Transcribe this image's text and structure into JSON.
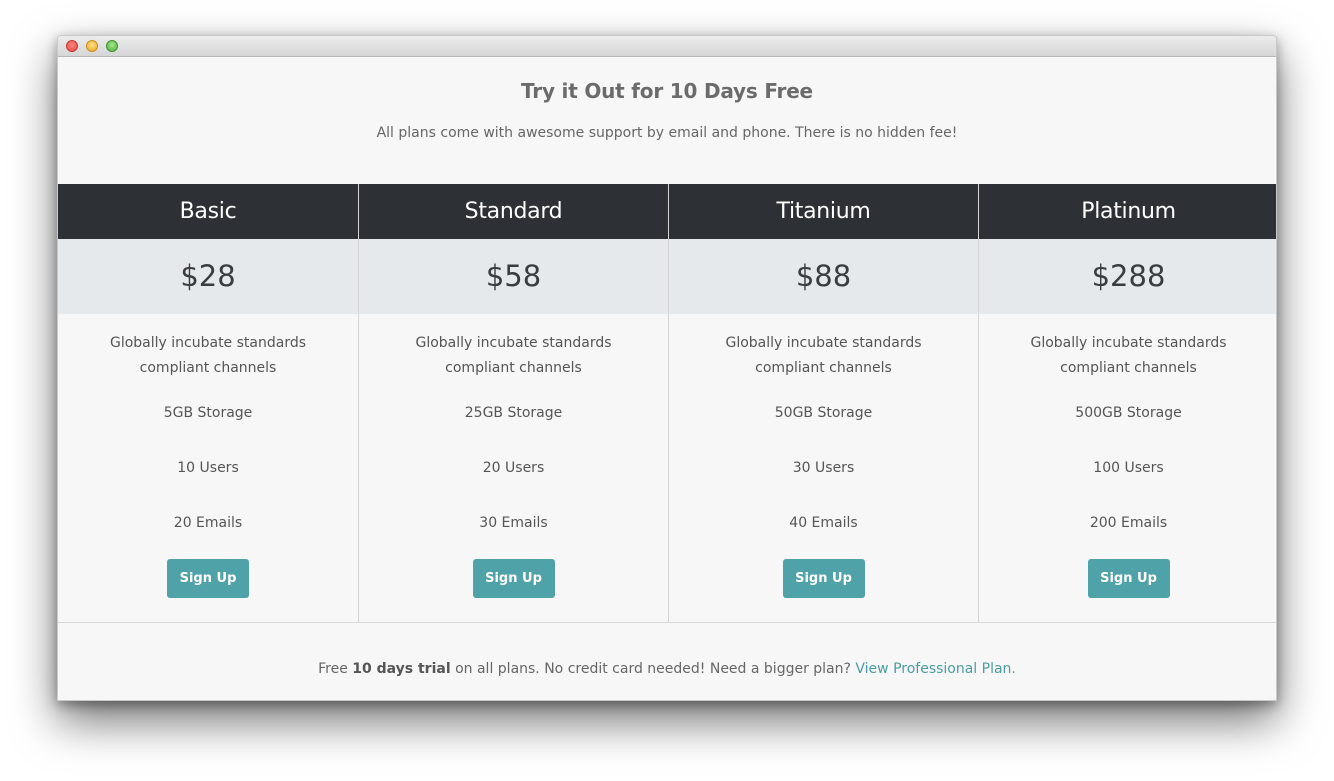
{
  "header": {
    "title": "Try it Out for 10 Days Free",
    "subtitle": "All plans come with awesome support by email and phone. There is no hidden fee!"
  },
  "plans": [
    {
      "name": "Basic",
      "price": "$28",
      "description": "Globally incubate standards compliant channels",
      "storage": "5GB Storage",
      "users": "10 Users",
      "emails": "20 Emails",
      "button": "Sign Up"
    },
    {
      "name": "Standard",
      "price": "$58",
      "description": "Globally incubate standards compliant channels",
      "storage": "25GB Storage",
      "users": "20 Users",
      "emails": "30 Emails",
      "button": "Sign Up"
    },
    {
      "name": "Titanium",
      "price": "$88",
      "description": "Globally incubate standards compliant channels",
      "storage": "50GB Storage",
      "users": "30 Users",
      "emails": "40 Emails",
      "button": "Sign Up"
    },
    {
      "name": "Platinum",
      "price": "$288",
      "description": "Globally incubate standards compliant channels",
      "storage": "500GB Storage",
      "users": "100 Users",
      "emails": "200 Emails",
      "button": "Sign Up"
    }
  ],
  "footer": {
    "prefix": "Free ",
    "bold": "10 days trial",
    "middle": " on all plans. No credit card needed! Need a bigger plan? ",
    "link": "View Professional Plan."
  },
  "colors": {
    "header_bg": "#2d3136",
    "price_bg": "#e6e9eb",
    "button": "#4fa3a8",
    "link": "#4a9ca3"
  }
}
